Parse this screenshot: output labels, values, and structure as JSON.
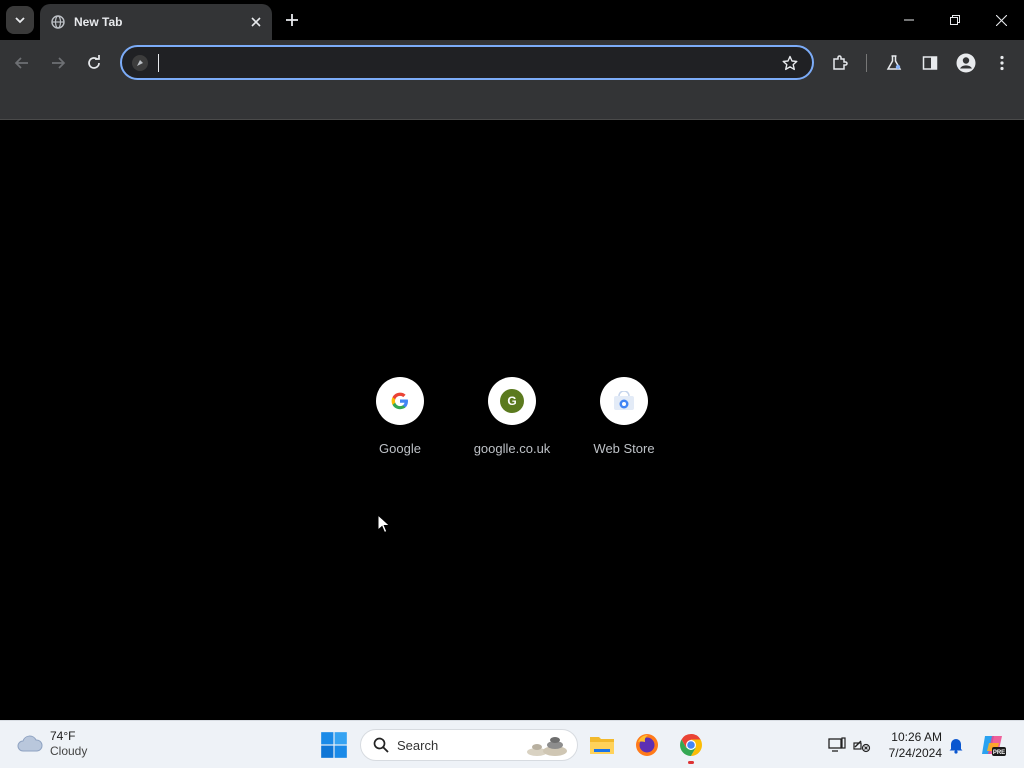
{
  "window": {
    "tab_title": "New Tab"
  },
  "omnibox": {
    "value": "",
    "placeholder": ""
  },
  "shortcuts": [
    {
      "label": "Google",
      "icon": "google-g-icon"
    },
    {
      "label": "googlle.co.uk",
      "icon": "letter-g-icon",
      "letter": "G",
      "color": "#5b7a1e"
    },
    {
      "label": "Web Store",
      "icon": "web-store-icon"
    }
  ],
  "taskbar": {
    "weather_temp": "74°F",
    "weather_desc": "Cloudy",
    "search_label": "Search",
    "time": "10:26 AM",
    "date": "7/24/2024"
  },
  "colors": {
    "accent": "#7cacf8",
    "toolbar": "#333436",
    "content_bg": "#000000"
  }
}
